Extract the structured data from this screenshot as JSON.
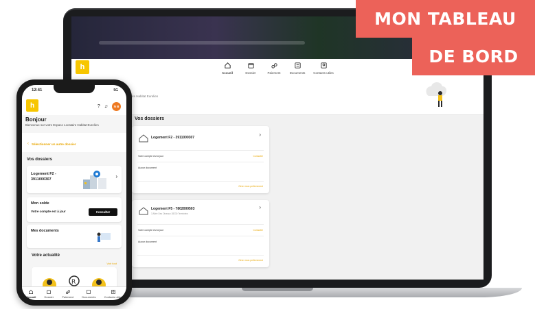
{
  "banner": {
    "line1": "MON TABLEAU",
    "line2": "DE BORD",
    "color": "#ec6259"
  },
  "brand": {
    "accent": "#f7c600",
    "link_color": "#e8a600",
    "logo_letter": "h"
  },
  "desktop": {
    "nav": [
      {
        "label": "Accueil",
        "icon": "home-icon",
        "active": true
      },
      {
        "label": "Dossier",
        "icon": "folder-icon",
        "active": false
      },
      {
        "label": "Paiement",
        "icon": "payment-icon",
        "active": false
      },
      {
        "label": "Documents",
        "icon": "document-icon",
        "active": false
      },
      {
        "label": "Contacts utiles",
        "icon": "contact-icon",
        "active": false
      }
    ],
    "hero_subtitle": "ire Habitat Eurelien",
    "section_title": "Vos dossiers",
    "dossiers": [
      {
        "title": "Logement F2 - 3911000307",
        "address": "",
        "account_status": "Votre compte est à jour",
        "consult": "Consulter",
        "documents": "Aucun document",
        "prelevement": "Gérer mon prélèvement"
      },
      {
        "title": "Logement F5 - 7802000503",
        "address": "3 Allée Des Oiseaux 28230 Terminiers",
        "account_status": "Votre compte est à jour",
        "consult": "Consulter",
        "documents": "Aucun document",
        "prelevement": "Gérer mon prélèvement"
      }
    ]
  },
  "phone": {
    "time": "12:41",
    "signal": "5G",
    "avatar_initials": "N B",
    "greeting": "Bonjour",
    "welcome": "Bienvenue sur votre Espace Locataire Habitat Eurelien",
    "select_dossier": "Sélectionner un autre dossier",
    "section_dossiers": "Vos dossiers",
    "dossier_title": "Logement F2 - 3911000307",
    "solde_title": "Mon solde",
    "solde_status": "Votre compte est à jour",
    "solde_button": "Consulter",
    "documents_title": "Mes documents",
    "news_title": "Votre actualité",
    "news_link": "Voir tout",
    "tabs": [
      {
        "label": "Accueil",
        "icon": "home-icon",
        "active": true
      },
      {
        "label": "Dossier",
        "icon": "folder-icon",
        "active": false
      },
      {
        "label": "Paiement",
        "icon": "payment-icon",
        "active": false
      },
      {
        "label": "Documents",
        "icon": "document-icon",
        "active": false
      },
      {
        "label": "Contacts utiles",
        "icon": "contact-icon",
        "active": false
      }
    ]
  }
}
